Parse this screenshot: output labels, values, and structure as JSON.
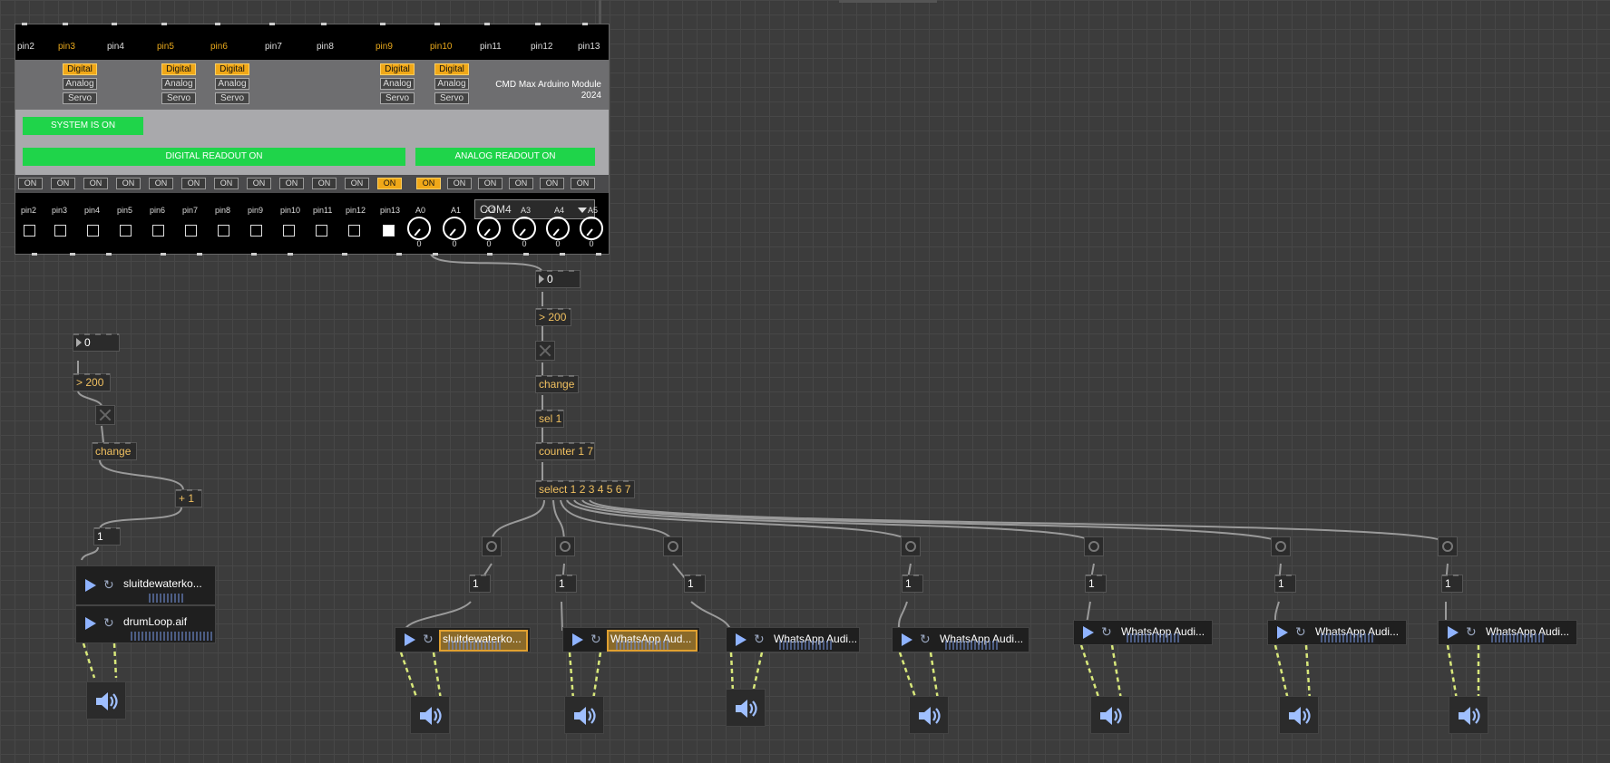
{
  "module": {
    "top_pins": [
      "pin2",
      "pin3",
      "pin4",
      "pin5",
      "pin6",
      "pin7",
      "pin8",
      "pin9",
      "pin10",
      "pin11",
      "pin12",
      "pin13"
    ],
    "highlighted_pins": [
      "pin3",
      "pin5",
      "pin6",
      "pin9",
      "pin10"
    ],
    "mode_labels": {
      "digital": "Digital",
      "analog": "Analog",
      "servo": "Servo"
    },
    "brand_line1": "CMD Max Arduino Module",
    "brand_line2": "2024",
    "system_button": "SYSTEM IS ON",
    "port": "COM4",
    "digital_readout": "DIGITAL READOUT ON",
    "analog_readout": "ANALOG READOUT ON",
    "on_label": "ON",
    "bottom_pins": [
      "pin2",
      "pin3",
      "pin4",
      "pin5",
      "pin6",
      "pin7",
      "pin8",
      "pin9",
      "pin10",
      "pin11",
      "pin12",
      "pin13"
    ],
    "analog_pins": [
      "A0",
      "A1",
      "A2",
      "A3",
      "A4",
      "A5"
    ],
    "analog_values": [
      "0",
      "0",
      "0",
      "0",
      "0",
      "0"
    ]
  },
  "left_chain": {
    "number": "0",
    "compare": "> 200",
    "change": "change",
    "plus": "+ 1",
    "count": "1",
    "players": [
      {
        "file": "sluitdewaterko..."
      },
      {
        "file": "drumLoop.aif"
      }
    ]
  },
  "main_chain": {
    "number": "0",
    "compare": "> 200",
    "change": "change",
    "sel": "sel 1",
    "counter": "counter 1 7",
    "select": "select 1 2 3 4 5 6 7"
  },
  "branches": {
    "counts": [
      "1",
      "1",
      "1",
      "1",
      "1",
      "1",
      "1"
    ],
    "players": [
      {
        "file": "sluitdewaterko...",
        "selected": true
      },
      {
        "file": "WhatsApp Aud...",
        "selected": true
      },
      {
        "file": "WhatsApp Audi...",
        "selected": false
      },
      {
        "file": "WhatsApp Audi...",
        "selected": false
      },
      {
        "file": "WhatsApp Audi...",
        "selected": false
      },
      {
        "file": "WhatsApp Audi...",
        "selected": false
      },
      {
        "file": "WhatsApp Audi...",
        "selected": false
      }
    ]
  }
}
